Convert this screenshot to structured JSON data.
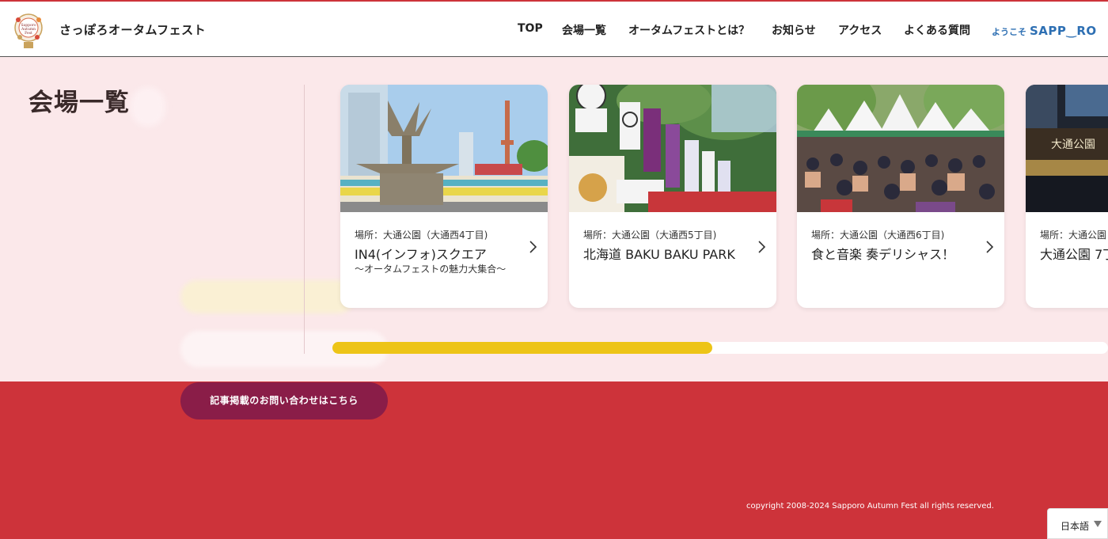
{
  "header": {
    "site_name": "さっぽろオータムフェスト",
    "nav": [
      {
        "label": "TOP"
      },
      {
        "label": "会場一覧"
      },
      {
        "label": "オータムフェストとは？"
      },
      {
        "label": "お知らせ"
      },
      {
        "label": "アクセス"
      },
      {
        "label": "よくある質問"
      }
    ],
    "welcome_prefix": "ようこそ",
    "welcome_brand": "SAPP‿RO",
    "brand_color": "#2d6fb3"
  },
  "venues": {
    "title": "会場一覧",
    "cards": [
      {
        "location": "場所：大通公園（大通西4丁目)",
        "name": "IN4(インフォ)スクエア",
        "subtitle": "〜オータムフェストの魅力大集合〜"
      },
      {
        "location": "場所：大通公園（大通西5丁目)",
        "name": "北海道 BAKU BAKU PARK",
        "subtitle": ""
      },
      {
        "location": "場所：大通公園（大通西6丁目)",
        "name": "食と音楽 奏デリシャス！",
        "subtitle": ""
      },
      {
        "location": "場所：大通公園",
        "name": "大通公園 7丁",
        "subtitle": ""
      }
    ],
    "scroll_progress_fraction": 0.49,
    "progress_color": "#edc417"
  },
  "footer": {
    "contact_button": "記事掲載のお問い合わせはこちら",
    "copyright": "copyright 2008-2024 Sapporo Autumn Fest all rights reserved.",
    "language": "日本語",
    "background_color": "#cd333a"
  }
}
